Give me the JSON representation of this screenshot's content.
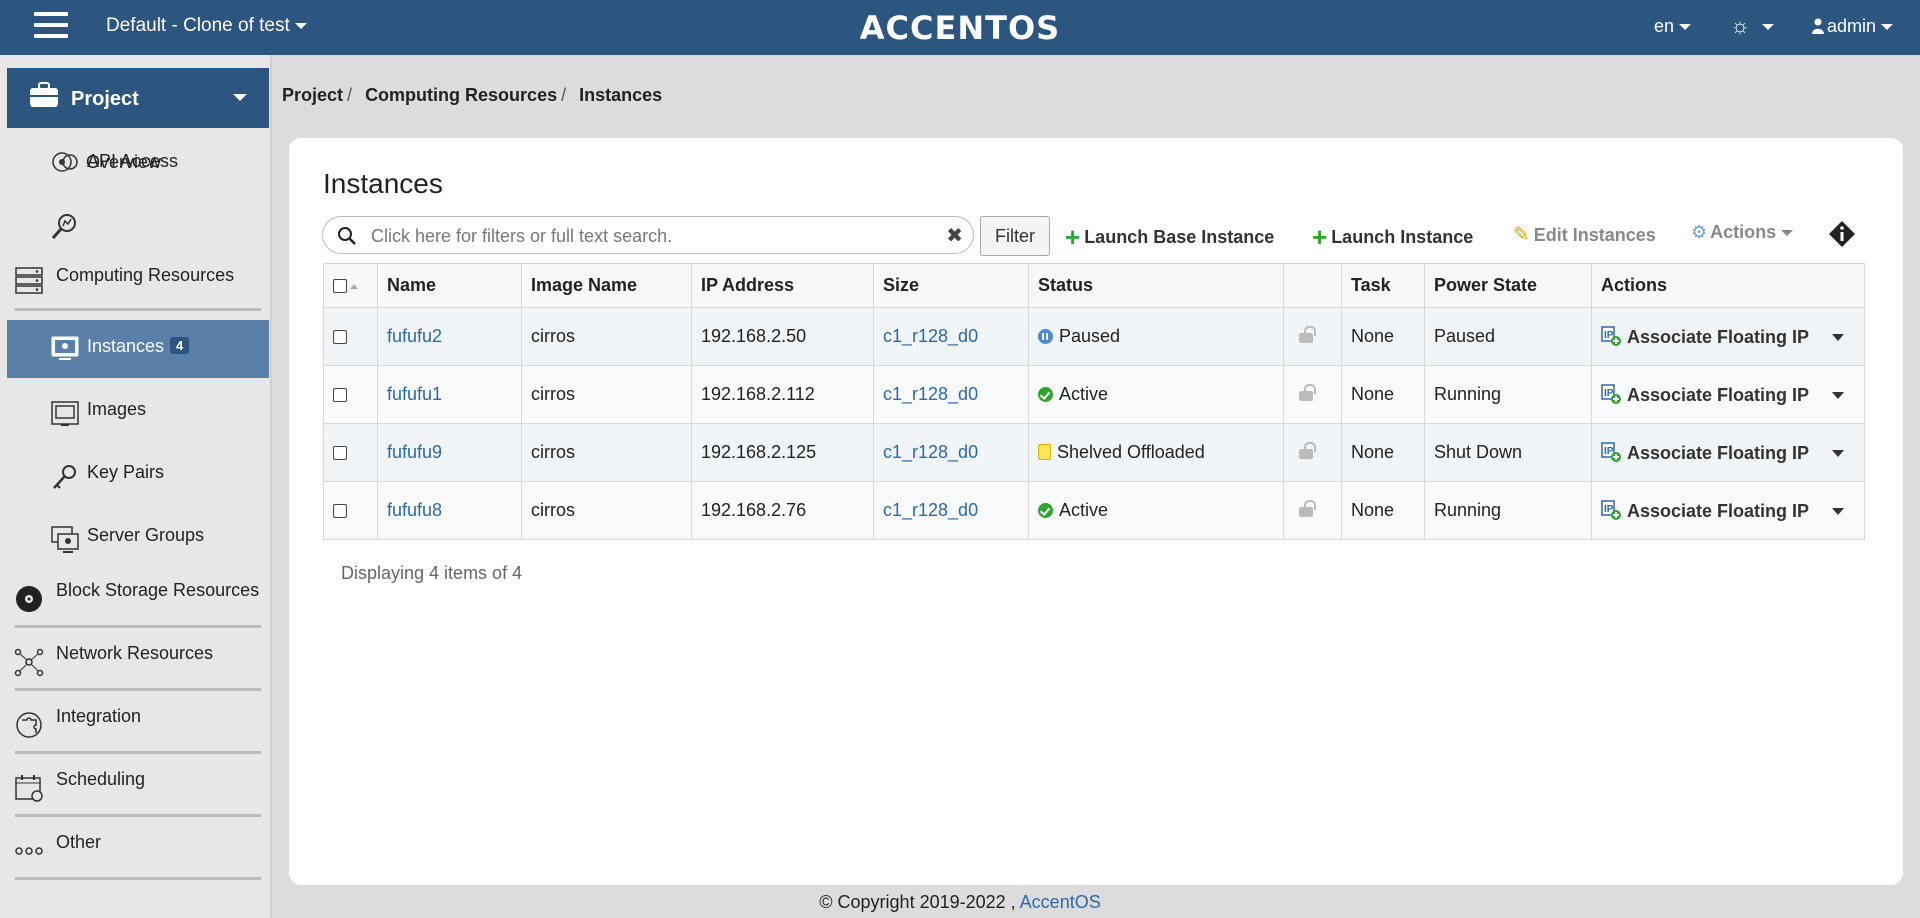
{
  "topbar": {
    "project": "Default - Clone of test",
    "logo": "ACCENTOS",
    "lang": "en",
    "user": "admin"
  },
  "sidebar": {
    "header": "Project",
    "items": [
      {
        "label": "API Access",
        "icon": "api-access-icon"
      },
      {
        "label": "Overview",
        "icon": "overview-icon"
      },
      {
        "label": "Computing Resources",
        "icon": "server-rack-icon"
      },
      {
        "label": "Instances",
        "icon": "monitor-icon",
        "badge": "4"
      },
      {
        "label": "Images",
        "icon": "image-icon"
      },
      {
        "label": "Key Pairs",
        "icon": "key-icon"
      },
      {
        "label": "Server Groups",
        "icon": "server-group-icon"
      },
      {
        "label": "Block Storage Resources",
        "icon": "disk-icon"
      },
      {
        "label": "Network Resources",
        "icon": "network-icon"
      },
      {
        "label": "Integration",
        "icon": "puzzle-icon"
      },
      {
        "label": "Scheduling",
        "icon": "calendar-icon"
      },
      {
        "label": "Other",
        "icon": "more-icon"
      }
    ]
  },
  "breadcrumb": [
    "Project",
    "Computing Resources",
    "Instances"
  ],
  "page_title": "Instances",
  "search": {
    "placeholder": "Click here for filters or full text search.",
    "value": ""
  },
  "toolbar": {
    "filter": "Filter",
    "launch_base": "Launch Base Instance",
    "launch": "Launch Instance",
    "edit": "Edit Instances",
    "actions": "Actions"
  },
  "table": {
    "headers": [
      "Name",
      "Image Name",
      "IP Address",
      "Size",
      "Status",
      "",
      "Task",
      "Power State",
      "Actions"
    ],
    "rows": [
      {
        "name": "fufufu2",
        "image": "cirros",
        "ip": "192.168.2.50",
        "size": "c1_r128_d0",
        "status": "Paused",
        "status_kind": "paused",
        "task": "None",
        "power": "Paused",
        "action": "Associate Floating IP"
      },
      {
        "name": "fufufu1",
        "image": "cirros",
        "ip": "192.168.2.112",
        "size": "c1_r128_d0",
        "status": "Active",
        "status_kind": "active",
        "task": "None",
        "power": "Running",
        "action": "Associate Floating IP"
      },
      {
        "name": "fufufu9",
        "image": "cirros",
        "ip": "192.168.2.125",
        "size": "c1_r128_d0",
        "status": "Shelved Offloaded",
        "status_kind": "shelved",
        "task": "None",
        "power": "Shut Down",
        "action": "Associate Floating IP"
      },
      {
        "name": "fufufu8",
        "image": "cirros",
        "ip": "192.168.2.76",
        "size": "c1_r128_d0",
        "status": "Active",
        "status_kind": "active",
        "task": "None",
        "power": "Running",
        "action": "Associate Floating IP"
      }
    ]
  },
  "count_text": "Displaying 4 items of 4",
  "footer": {
    "text": "© Copyright 2019-2022 ,",
    "link": "AccentOS"
  }
}
